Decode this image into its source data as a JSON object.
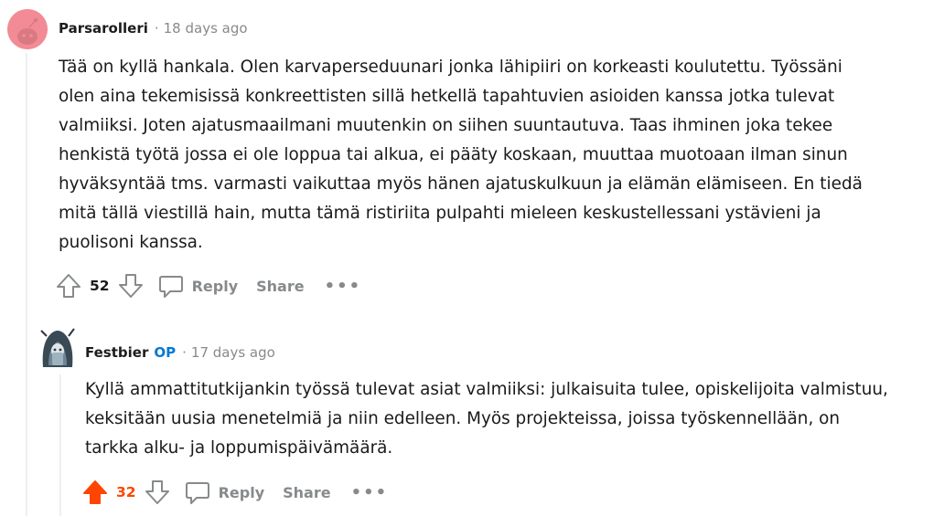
{
  "comments": [
    {
      "author": "Parsarolleri",
      "separator": "·",
      "time": "18 days ago",
      "lines": [
        "Tää on kyllä hankala. Olen karvaperseduunari jonka lähipiiri on korkeasti koulutettu. Työssäni",
        "olen aina tekemisissä konkreettisten sillä hetkellä tapahtuvien asioiden kanssa jotka tulevat",
        "valmiiksi. Joten ajatusmaailmani muutenkin on siihen suuntautuva. Taas ihminen joka tekee",
        "henkistä työtä jossa ei ole loppua tai alkua, ei pääty koskaan, muuttaa muotoaan ilman sinun",
        "hyväksyntää tms. varmasti vaikuttaa myös hänen ajatuskulkuun ja elämän elämiseen. En tiedä",
        "mitä tällä viestillä hain, mutta tämä ristiriita pulpahti mieleen keskustellessani ystävieni ja",
        "puolisoni kanssa."
      ],
      "score": "52",
      "reply_label": "Reply",
      "share_label": "Share",
      "more_label": "•••"
    },
    {
      "author": "Festbier",
      "op_badge": "OP",
      "separator": "·",
      "time": "17 days ago",
      "lines": [
        "Kyllä ammattitutkijankin työssä tulevat asiat valmiiksi: julkaisuita tulee, opiskelijoita valmistuu,",
        "keksitään uusia menetelmiä ja niin edelleen. Myös projekteissa, joissa työskennellään, on",
        "tarkka alku- ja loppumispäivämäärä."
      ],
      "score": "32",
      "upvoted": true,
      "reply_label": "Reply",
      "share_label": "Share",
      "more_label": "•••"
    }
  ],
  "colors": {
    "upvote_active": "#ff4500",
    "op_badge": "#0079d3",
    "muted": "#878a8c",
    "avatar_pink": "#f28b95"
  }
}
